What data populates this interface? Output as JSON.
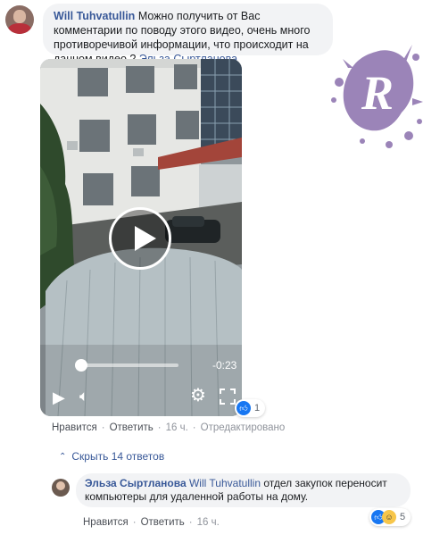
{
  "comment": {
    "author": "Will Tuhvatullin",
    "text": "Можно получить от Вас комментарии по поводу этого видео, очень много противоречивой информации, что происходит на данном видео ?",
    "mention": "Эльза Сыртланова"
  },
  "video": {
    "time_left": "-0:23",
    "progress": 0.05
  },
  "reactions": {
    "count": "1"
  },
  "actions": {
    "like": "Нравится",
    "reply": "Ответить",
    "time": "16 ч.",
    "edited": "Отредактировано"
  },
  "replies_toggle": "Скрыть 14 ответов",
  "reply": {
    "author": "Эльза Сыртланова",
    "mention": "Will Tuhvatullin",
    "text": "отдел закупок переносит компьютеры для удаленной работы на дому.",
    "reaction_count": "5",
    "like": "Нравится",
    "reply": "Ответить",
    "time": "16 ч."
  },
  "icons": {
    "play": "play-icon",
    "volume": "mute-icon",
    "settings": "gear-icon",
    "fullscreen": "fullscreen-icon",
    "like": "like-icon",
    "haha": "haha-icon",
    "chevron": "chevron-up-icon"
  },
  "colors": {
    "link": "#385898",
    "bubble": "#f2f3f5",
    "like": "#1877f2",
    "logo": "#9b84b8"
  }
}
